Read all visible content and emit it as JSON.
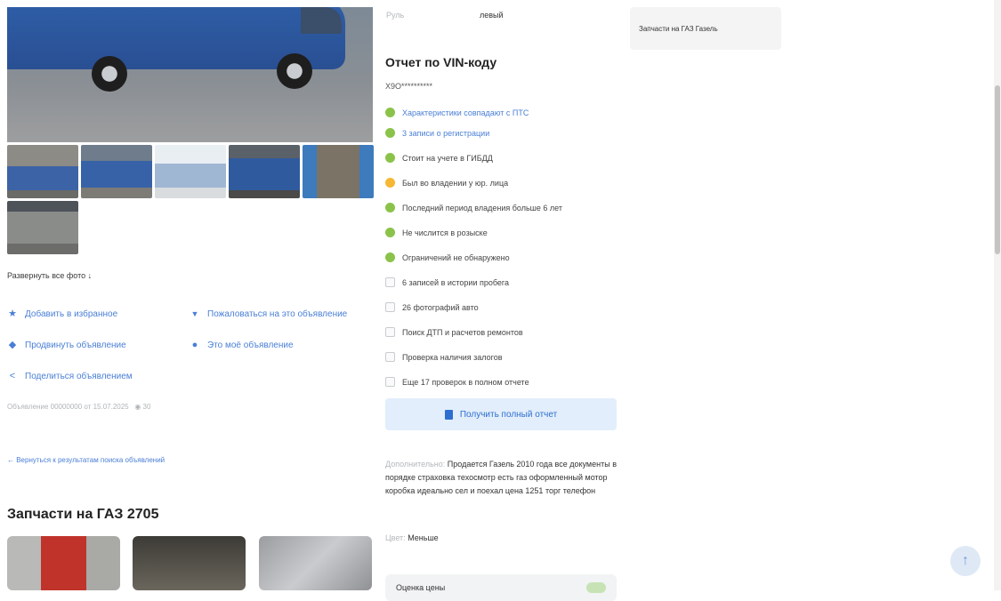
{
  "params": {
    "label": "Руль",
    "value": "левый"
  },
  "left": {
    "photos_link": "Развернуть все фото ↓",
    "actions": [
      {
        "icon": "star-icon",
        "glyph": "★",
        "label": "Добавить в избранное"
      },
      {
        "icon": "thumbs-down-icon",
        "glyph": "👎",
        "label": "Пожаловаться на это объявление"
      },
      {
        "icon": "rocket-icon",
        "glyph": "◆",
        "label": "Продвинуть объявление"
      },
      {
        "icon": "person-icon",
        "glyph": "●",
        "label": "Это моё объявление"
      },
      {
        "icon": "share-icon",
        "glyph": "<",
        "label": "Поделиться объявлением"
      }
    ],
    "meta": "Объявление 00000000 от 15.07.2025",
    "views": "30",
    "back_link": "← Вернуться к результатам поиска объявлений",
    "parts_title": "Запчасти на ГАЗ 2705"
  },
  "vin": {
    "title": "Отчет по VIN-коду",
    "code": "X9O**********",
    "checks": [
      {
        "status": "green",
        "text": "Характеристики совпадают с ПТС",
        "link": true
      },
      {
        "status": "green",
        "text": "3 записи о регистрации",
        "link": true
      },
      {
        "status": "green",
        "text": "Стоит на учете в ГИБДД",
        "link": false
      },
      {
        "status": "yellow",
        "text": "Был во владении у юр. лица",
        "link": false
      },
      {
        "status": "green",
        "text": "Последний период владения больше 6 лет",
        "link": false
      },
      {
        "status": "green",
        "text": "Не числится в розыске",
        "link": false
      },
      {
        "status": "green",
        "text": "Ограничений не обнаружено",
        "link": false
      },
      {
        "status": "none",
        "text": "6 записей в истории пробега",
        "link": false
      },
      {
        "status": "none",
        "text": "26 фотографий авто",
        "link": false
      },
      {
        "status": "none",
        "text": "Поиск ДТП и расчетов ремонтов",
        "link": false
      },
      {
        "status": "none",
        "text": "Проверка наличия залогов",
        "link": false
      },
      {
        "status": "none",
        "text": "Еще 17 проверок в полном отчете",
        "link": false
      }
    ],
    "button": "Получить полный отчет"
  },
  "description": {
    "label": "Дополнительно:",
    "text": "Продается Газель 2010 года все документы в порядке страховка техосмотр есть газ оформленный мотор коробка идеально сел и поехал цена 1251 торг телефон"
  },
  "color": {
    "label": "Цвет:",
    "value": "Меньше"
  },
  "bottom_card": {
    "label": "Оценка цены"
  },
  "sidebar": {
    "card_text": "Запчасти на ГАЗ Газель"
  },
  "colors": {
    "accent": "#4a7fd6",
    "green": "#8bc34a",
    "yellow": "#f6b735"
  }
}
